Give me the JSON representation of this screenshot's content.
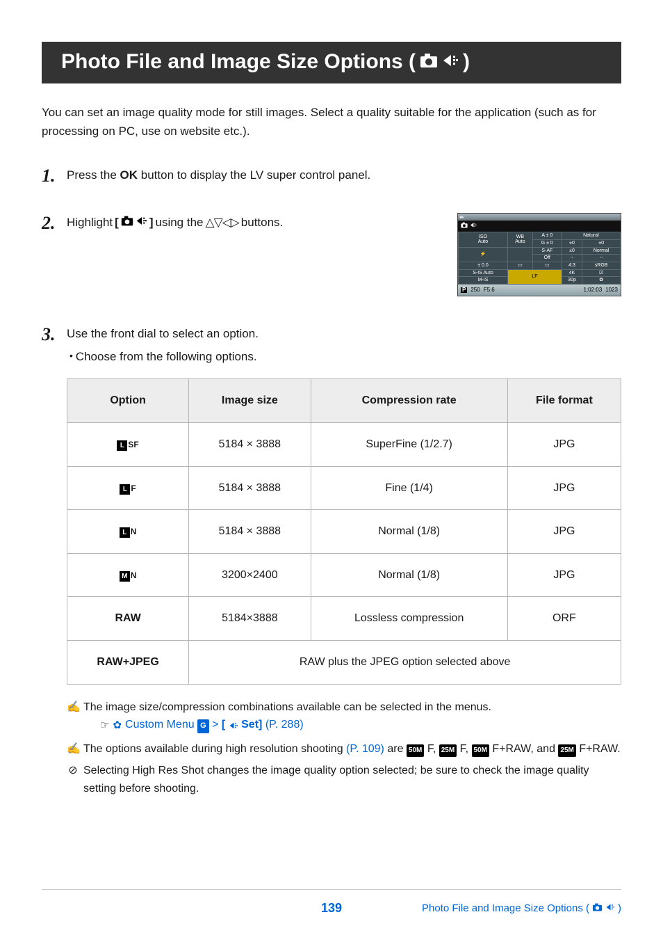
{
  "title": {
    "text_before_icons": "Photo File and Image Size Options (",
    "text_after_icons": ")"
  },
  "intro": "You can set an image quality mode for still images. Select a quality suitable for the application (such as for processing on PC, use on website etc.).",
  "steps": {
    "s1": {
      "num": "1",
      "pre": "Press the ",
      "bold": "OK",
      "post": " button to display the LV super control panel."
    },
    "s2": {
      "num": "2",
      "pre": "Highlight ",
      "bracket_open": "[",
      "bracket_close": "]",
      "mid": " using the ",
      "btns": "△▽◁▷",
      "post": " buttons."
    },
    "s3": {
      "num": "3",
      "line": "Use the front dial to select an option.",
      "bullet": "Choose from the following options."
    }
  },
  "mini": {
    "selected": "K",
    "r1": {
      "iso_l1": "ISO",
      "iso_l2": "Auto",
      "wb_l1": "WB",
      "wb_l2": "Auto",
      "a": "A ± 0",
      "g": "G ± 0",
      "nat": "Natural"
    },
    "r2": {
      "flash": "⚡",
      "saf": "S-AF",
      "off": "Off",
      "s0": "±0",
      "v0": "±0",
      "norm": "Normal"
    },
    "r3": {
      "pm0": "± 0.0",
      "rect": "▭",
      "card": "▭",
      "r43": "4:3",
      "srgb": "sRGB"
    },
    "r4": {
      "sis": "S-IS Auto",
      "mis": "M-IS",
      "lf": "LF",
      "k4": "4K",
      "p30": "30p",
      "sq": "☑",
      "gear": "✿"
    },
    "bottom": {
      "p": "P",
      "sh": "250",
      "ap": "F5.6",
      "time": "1:02:03",
      "shots": "1023"
    }
  },
  "table": {
    "headers": {
      "opt": "Option",
      "size": "Image size",
      "comp": "Compression rate",
      "fmt": "File format"
    },
    "rows": [
      {
        "opt_box": "L",
        "opt_sub": "SF",
        "size": "5184 × 3888",
        "comp": "SuperFine (1/2.7)",
        "fmt": "JPG"
      },
      {
        "opt_box": "L",
        "opt_sub": "F",
        "size": "5184 × 3888",
        "comp": "Fine (1/4)",
        "fmt": "JPG"
      },
      {
        "opt_box": "L",
        "opt_sub": "N",
        "size": "5184 × 3888",
        "comp": "Normal (1/8)",
        "fmt": "JPG"
      },
      {
        "opt_box": "M",
        "opt_sub": "N",
        "size": "3200×2400",
        "comp": "Normal (1/8)",
        "fmt": "JPG"
      },
      {
        "opt_text": "RAW",
        "size": "5184×3888",
        "comp": "Lossless compression",
        "fmt": "ORF"
      },
      {
        "opt_text": "RAW+JPEG",
        "span_text": "RAW plus the JPEG option selected above"
      }
    ]
  },
  "notes": {
    "n1": "The image size/compression combinations available can be selected in the menus.",
    "n1_link_pre": "Custom Menu ",
    "n1_link_g": "G",
    "n1_link_mid": " > ",
    "n1_link_bracket_open": "[",
    "n1_link_set": "Set]",
    "n1_link_page": "(P. 288)",
    "n2_pre": "The options available during high resolution shooting ",
    "n2_link": "(P. 109)",
    "n2_mid": " are ",
    "n2_b1": "50M",
    "n2_b1s": "F, ",
    "n2_b2": "25M",
    "n2_b2s": "F, ",
    "n2_b3": "50M",
    "n2_b3s": "F+RAW, and ",
    "n2_b4": "25M",
    "n2_b4s": "F+RAW.",
    "n3": "Selecting High Res Shot changes the image quality option selected; be sure to check the image quality setting before shooting."
  },
  "footer": {
    "page": "139",
    "bc_text": "Photo File and Image Size Options (",
    "bc_close": ")"
  }
}
